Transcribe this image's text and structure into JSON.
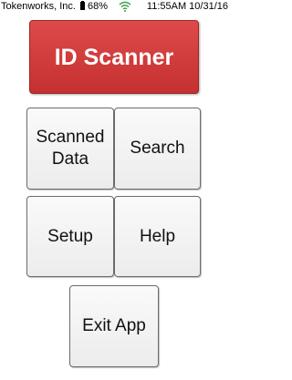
{
  "status_bar": {
    "carrier": "Tokenworks, Inc.",
    "battery": "68%",
    "time_date": "11:55AM 10/31/16"
  },
  "buttons": {
    "id_scanner": "ID Scanner",
    "scanned_data": "Scanned\nData",
    "search": "Search",
    "setup": "Setup",
    "help": "Help",
    "exit_app": "Exit App"
  }
}
